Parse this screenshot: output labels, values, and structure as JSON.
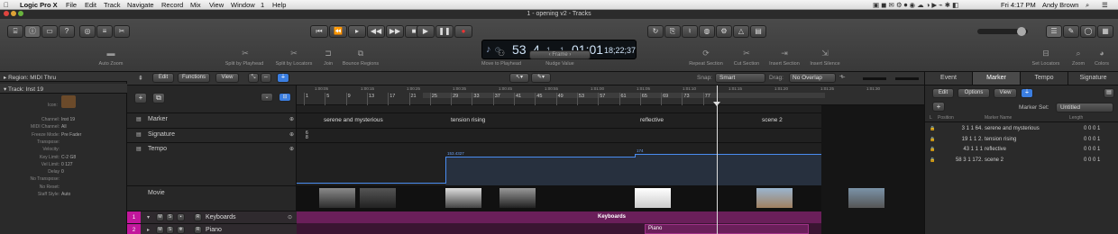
{
  "menubar": {
    "apple": "",
    "app": "Logic Pro X",
    "items": [
      "File",
      "Edit",
      "Track",
      "Navigate",
      "Record",
      "Mix",
      "View",
      "Window",
      "1",
      "Help"
    ],
    "clock": "Fri 4:17 PM",
    "user": "Andy Brown"
  },
  "window_title": "1 - opening v2 - Tracks",
  "lcd": {
    "tempo_bar": "53",
    "beat": "4",
    "div": "1",
    "tick": "1",
    "time": "01:01",
    "frames": "18;22;37"
  },
  "toolbar_labels": {
    "auto_zoom": "Auto Zoom",
    "split_playhead": "Split by Playhead",
    "split_locators": "Split by Locators",
    "join": "Join",
    "bounce_regions": "Bounce Regions",
    "move_playhead": "Move to Playhead",
    "frame": "Frame",
    "nudge_value": "Nudge Value",
    "repeat_section": "Repeat Section",
    "cut_section": "Cut Section",
    "insert_section": "Insert Section",
    "insert_silence": "Insert Silence",
    "set_locators": "Set Locators",
    "zoom": "Zoom",
    "colors": "Colors"
  },
  "inspector": {
    "region_header": "Region: MIDI Thru",
    "track_header": "Track: Inst 19",
    "icon_label": "Icon:",
    "rows": [
      {
        "label": "Channel:",
        "value": "Inst 19"
      },
      {
        "label": "MIDI Channel:",
        "value": "All"
      },
      {
        "label": "Freeze Mode:",
        "value": "Pre Fader"
      },
      {
        "label": "Transpose:",
        "value": ""
      },
      {
        "label": "Velocity:",
        "value": ""
      },
      {
        "label": "Key Limit:",
        "value": "C-2     G8"
      },
      {
        "label": "Vel Limit:",
        "value": "0     127"
      },
      {
        "label": "Delay",
        "value": "0"
      },
      {
        "label": "No Transpose:",
        "value": ""
      },
      {
        "label": "No Reset:",
        "value": ""
      },
      {
        "label": "Staff Style:",
        "value": "Auto"
      }
    ]
  },
  "arrange_toolbar": {
    "edit": "Edit",
    "functions": "Functions",
    "view": "View",
    "snap_label": "Snap:",
    "snap_value": "Smart",
    "drag_label": "Drag:",
    "drag_value": "No Overlap"
  },
  "global_tracks": {
    "marker": "Marker",
    "signature": "Signature",
    "tempo": "Tempo",
    "movie": "Movie",
    "sig_value_top": "6",
    "sig_value_bottom": "8",
    "tempo_scale": [
      "200",
      "180",
      "160",
      "120",
      "70"
    ]
  },
  "ruler": {
    "bars": [
      "1",
      "5",
      "9",
      "13",
      "17",
      "21",
      "25",
      "29",
      "33",
      "37",
      "41",
      "45",
      "49",
      "53",
      "57",
      "61",
      "65",
      "69",
      "73",
      "77"
    ],
    "times": [
      "1:00:05",
      "1:00:15",
      "1:00:25",
      "1:00:35",
      "1:00:45",
      "1:00:55",
      "1:01:00",
      "1:01:05",
      "1:01:10",
      "1:01:15",
      "1:01:20",
      "1:01:25",
      "1:01:30"
    ]
  },
  "markers_on_lane": [
    "serene and mysterious",
    "tension rising",
    "reflective",
    "scene 2"
  ],
  "tempo_values": [
    "153.4327",
    "174"
  ],
  "tracks": [
    {
      "num": "1",
      "name": "Keyboards",
      "region": "Keyboards"
    },
    {
      "num": "2",
      "name": "Piano",
      "region": "Piano"
    }
  ],
  "marker_list": {
    "tabs": [
      "Event",
      "Marker",
      "Tempo",
      "Signature"
    ],
    "edit": "Edit",
    "options": "Options",
    "view": "View",
    "marker_set_label": "Marker Set:",
    "marker_set_value": "Untitled",
    "col_position": "Position",
    "col_name": "Marker Name",
    "col_length": "Length",
    "rows": [
      {
        "pos": "3  1  1   64.",
        "name": "serene and mysterious",
        "len": "0  0  0     1"
      },
      {
        "pos": "19  1  1    2.",
        "name": "tension rising",
        "len": "0  0  0     1"
      },
      {
        "pos": "43  1  1     1",
        "name": "reflective",
        "len": "0  0  0     1"
      },
      {
        "pos": "58  3  1  172.",
        "name": "scene 2",
        "len": "0  0  0     1"
      }
    ]
  },
  "colors": {
    "accent": "#3b7ee0",
    "region_purple": "#6a1f5a",
    "track_purple": "#c2179c",
    "tempo_line": "#4a8cf0"
  }
}
